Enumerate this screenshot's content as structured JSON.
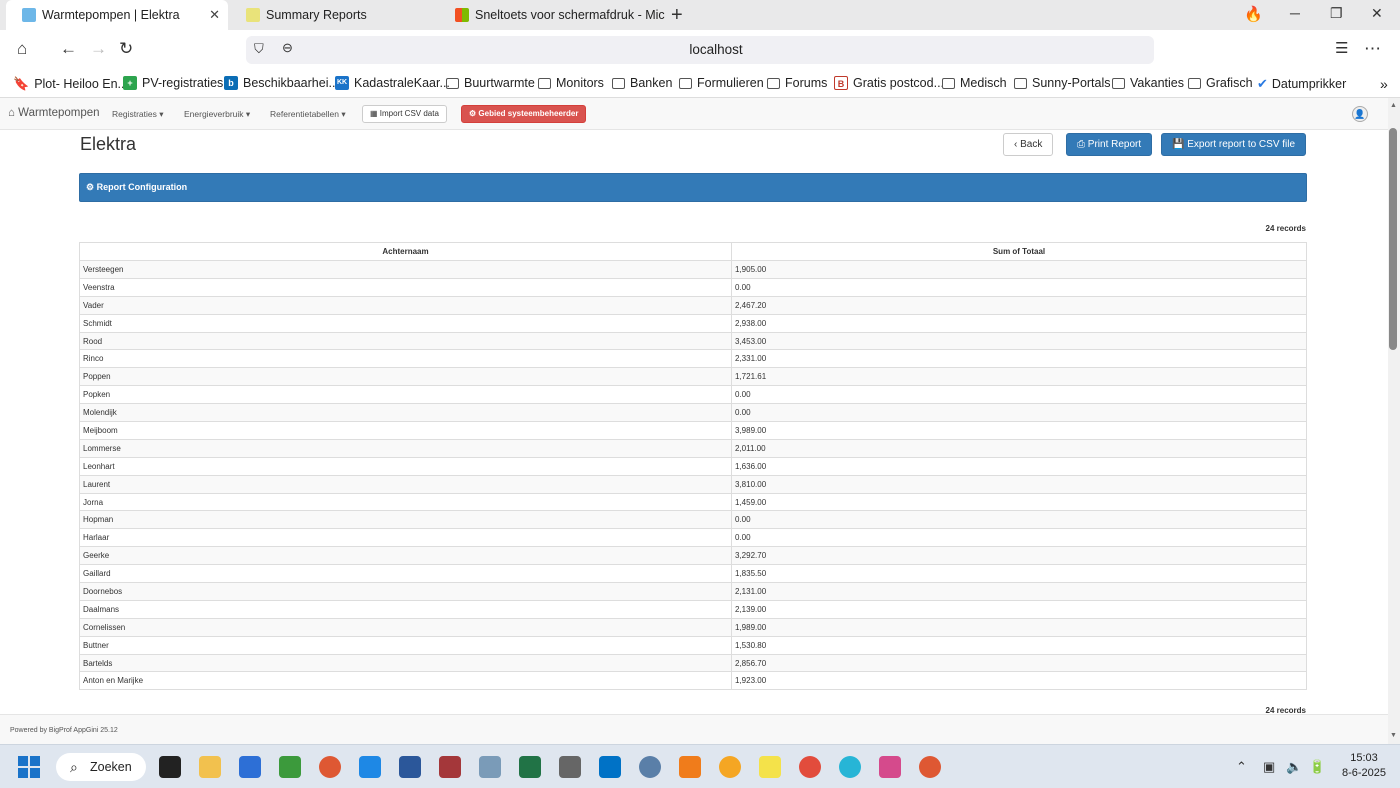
{
  "browser": {
    "tabs": [
      {
        "label": "Warmtepompen | Elektra",
        "active": true
      },
      {
        "label": "Summary Reports",
        "active": false
      },
      {
        "label": "Sneltoets voor schermafdruk - Microsc",
        "active": false
      }
    ],
    "new_tab": "+",
    "url": "localhost",
    "bookmarks": [
      "Plot- Heiloo En...",
      "PV-registraties",
      "Beschikbaarhei...",
      "KadastraleKaar...",
      "Buurtwarmte",
      "Monitors",
      "Banken",
      "Formulieren",
      "Forums",
      "Gratis postcod...",
      "Medisch",
      "Sunny-Portals",
      "Vakanties",
      "Grafisch",
      "Datumprikker"
    ]
  },
  "app_nav": {
    "brand": "Warmtepompen",
    "menus": [
      "Registraties",
      "Energieverbruik",
      "Referentietabellen"
    ],
    "import_label": "Import CSV data",
    "admin_label": "Gebied systeembeheerder"
  },
  "page": {
    "title": "Elektra",
    "back_label": "Back",
    "print_label": "Print Report",
    "export_label": "Export report to CSV file",
    "config_label": "Report Configuration",
    "records_label": "24 records"
  },
  "table": {
    "headers": [
      "Achternaam",
      "Sum of Totaal"
    ],
    "rows": [
      [
        "Versteegen",
        "1,905.00"
      ],
      [
        "Veenstra",
        "0.00"
      ],
      [
        "Vader",
        "2,467.20"
      ],
      [
        "Schmidt",
        "2,938.00"
      ],
      [
        "Rood",
        "3,453.00"
      ],
      [
        "Rinco",
        "2,331.00"
      ],
      [
        "Poppen",
        "1,721.61"
      ],
      [
        "Popken",
        "0.00"
      ],
      [
        "Molendijk",
        "0.00"
      ],
      [
        "Meijboom",
        "3,989.00"
      ],
      [
        "Lommerse",
        "2,011.00"
      ],
      [
        "Leonhart",
        "1,636.00"
      ],
      [
        "Laurent",
        "3,810.00"
      ],
      [
        "Jorna",
        "1,459.00"
      ],
      [
        "Hopman",
        "0.00"
      ],
      [
        "Harlaar",
        "0.00"
      ],
      [
        "Geerke",
        "3,292.70"
      ],
      [
        "Gaillard",
        "1,835.50"
      ],
      [
        "Doornebos",
        "2,131.00"
      ],
      [
        "Daalmans",
        "2,139.00"
      ],
      [
        "Cornelissen",
        "1,989.00"
      ],
      [
        "Buttner",
        "1,530.80"
      ],
      [
        "Bartelds",
        "2,856.70"
      ],
      [
        "Anton en Marijke",
        "1,923.00"
      ]
    ]
  },
  "footer": {
    "text": "Powered by BigProf AppGini 25.12"
  },
  "taskbar": {
    "search_label": "Zoeken",
    "time": "15:03",
    "date": "8-6-2025"
  }
}
